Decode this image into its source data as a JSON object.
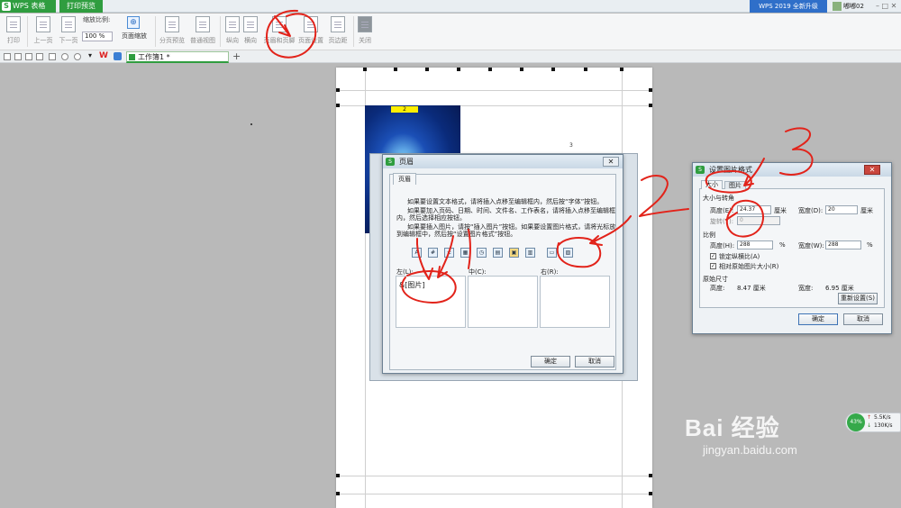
{
  "titlebar": {
    "app_tab": "WPS 表格",
    "preview_tab": "打印预览",
    "upgrade": "WPS 2019 全新升级",
    "user": "嘟嘟02",
    "controls": "– □ ✕"
  },
  "toolbar": {
    "print": "打印",
    "prev_page": "上一页",
    "next_page": "下一页",
    "zoom_label": "缩放比例:",
    "zoom_value": "100 %",
    "page_zoom": "页面缩放",
    "page_break_preview": "分页预览",
    "normal_view": "普通视图",
    "portrait": "纵向",
    "landscape": "横向",
    "header_footer": "页眉和页脚",
    "page_setup": "页面设置",
    "margins": "页边距",
    "close": "关闭"
  },
  "tabs": {
    "document": "工作簿1 *",
    "add": "+"
  },
  "page": {
    "header_image_badge": "2",
    "page_number": "3"
  },
  "header_dialog": {
    "title": "页眉",
    "tab": "页眉",
    "help_1": "如果要设置文本格式，请将插入点移至编辑框内，然后按“字体”按钮。",
    "help_2": "如果要加入页码、日期、时间、文件名、工作表名，请将插入点移至编辑框内，然后选择相应按钮。",
    "help_3": "如果要插入图片，请按“插入图片”按钮。如果要设置图片格式，请将光标放到编辑框中，然后按“设置图片格式”按钮。",
    "left_label": "左(L):",
    "center_label": "中(C):",
    "right_label": "右(R):",
    "left_content": "&[图片]",
    "ok": "确定",
    "cancel": "取消",
    "close": "✕"
  },
  "picture_format_dialog": {
    "title": "设置图片格式",
    "tab_size": "大小",
    "tab_picture": "图片",
    "section_size": "大小与转角",
    "height_label": "高度(E):",
    "height_value": "24.37",
    "height_unit": "厘米",
    "width_label": "宽度(D):",
    "width_value": "20",
    "width_unit": "厘米",
    "rotation_label": "旋转(T):",
    "rotation_value": "0",
    "section_scale": "比例",
    "scale_height_label": "高度(H):",
    "scale_height_value": "288",
    "scale_width_label": "宽度(W):",
    "scale_width_value": "288",
    "percent": "%",
    "lock_aspect": "锁定纵横比(A)",
    "relative_original": "相对原始图片大小(R)",
    "section_original": "原始尺寸",
    "orig_height_label": "高度:",
    "orig_height": "8.47 厘米",
    "orig_width_label": "宽度:",
    "orig_width": "6.95 厘米",
    "reset": "重新设置(S)",
    "ok": "确定",
    "cancel": "取消",
    "close": "✕"
  },
  "annotations": [
    "1",
    "2",
    "3"
  ],
  "network": {
    "percent": "43%",
    "up": "5.5K/s",
    "down": "130K/s"
  },
  "watermark": {
    "main": "Bai 经验",
    "sub": "jingyan.baidu.com"
  },
  "colors": {
    "accent_green": "#2f9d3f",
    "annotation_red": "#e2231a",
    "upgrade_blue": "#2f6fc9"
  }
}
